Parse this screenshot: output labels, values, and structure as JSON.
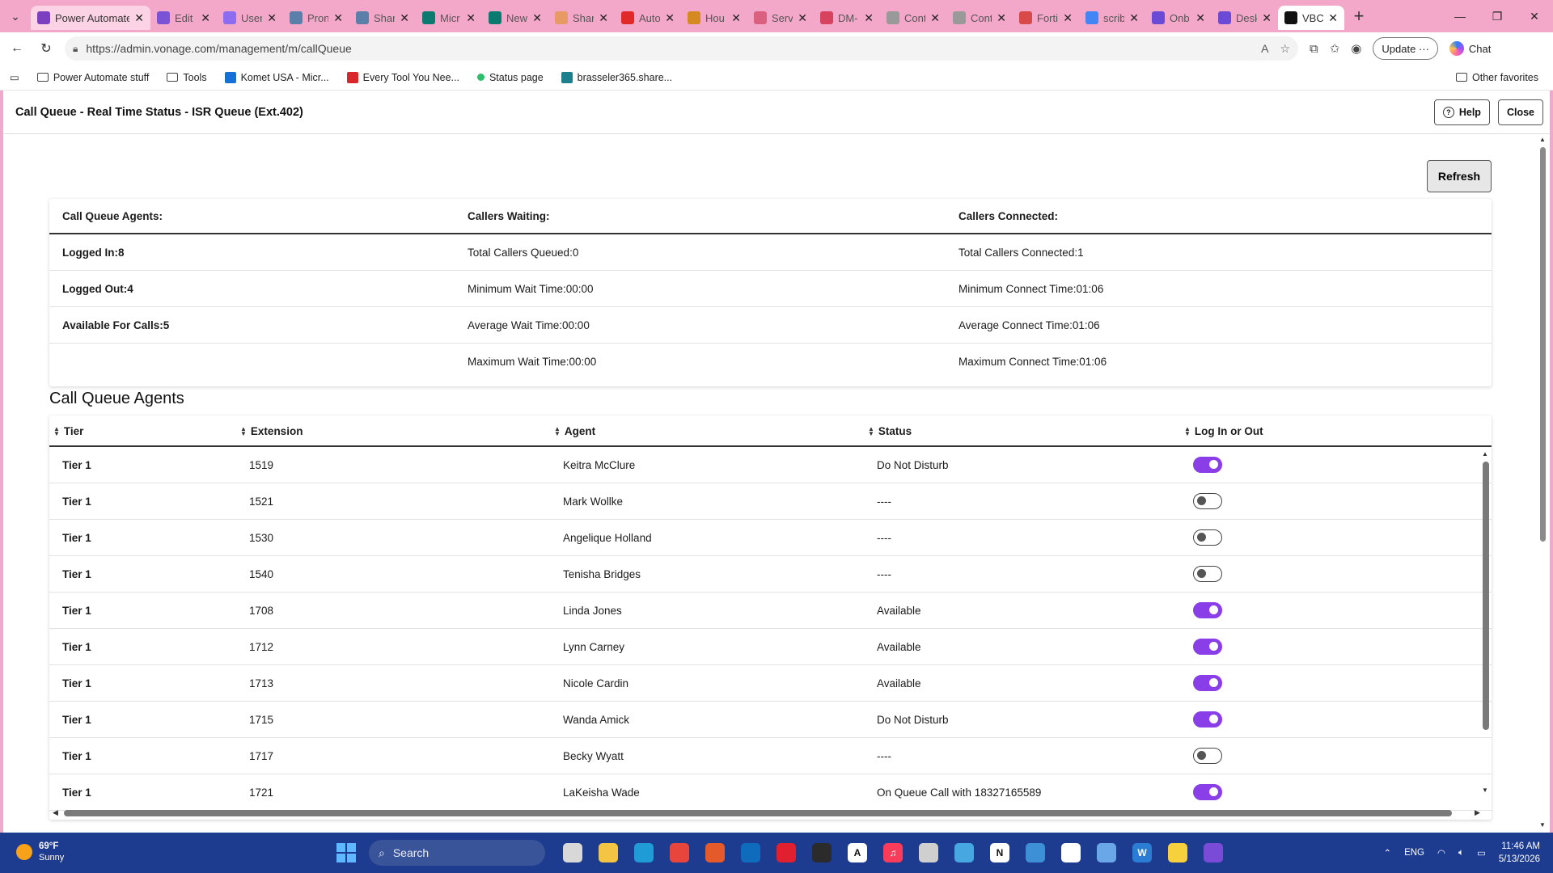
{
  "browser": {
    "tabs": [
      {
        "label": "Power Automate stuff",
        "icon": "windows-workspace-icon",
        "color": "#7b3fbf",
        "pinned": true
      },
      {
        "label": "Edit",
        "icon": "power-apps-icon",
        "color": "#7a52d6"
      },
      {
        "label": "User",
        "icon": "power-automate-icon",
        "color": "#8e6cf0"
      },
      {
        "label": "Pron",
        "icon": "sharepoint-icon",
        "color": "#5a7fa8"
      },
      {
        "label": "Shar",
        "icon": "sharepoint-icon",
        "color": "#5a7fa8"
      },
      {
        "label": "Micr",
        "icon": "ms-forms-icon",
        "color": "#0b7a6f"
      },
      {
        "label": "New",
        "icon": "ms-forms-icon",
        "color": "#0b7a6f"
      },
      {
        "label": "Shar",
        "icon": "office-icon",
        "color": "#e79a63"
      },
      {
        "label": "Auto",
        "icon": "youtube-icon",
        "color": "#e02a2a"
      },
      {
        "label": "Hou",
        "icon": "folder-icon",
        "color": "#d58a21"
      },
      {
        "label": "Serv",
        "icon": "service-icon",
        "color": "#d9607e"
      },
      {
        "label": "DM-",
        "icon": "pdf-icon",
        "color": "#d7425f"
      },
      {
        "label": "Cont",
        "icon": "gear-icon",
        "color": "#999999"
      },
      {
        "label": "Cont",
        "icon": "gear-icon",
        "color": "#999999"
      },
      {
        "label": "Forti",
        "icon": "forti-icon",
        "color": "#d84a4a"
      },
      {
        "label": "scrib",
        "icon": "google-icon",
        "color": "#4285f4"
      },
      {
        "label": "Onb",
        "icon": "search-g-icon",
        "color": "#6b4ad6"
      },
      {
        "label": "Desk",
        "icon": "search-g-icon",
        "color": "#6b4ad6"
      },
      {
        "label": "VBC",
        "icon": "vonage-icon",
        "color": "#111111",
        "active": true
      }
    ],
    "url": "https://admin.vonage.com/management/m/callQueue",
    "update_label": "Update",
    "chat_label": "Chat",
    "favorites": [
      {
        "label": "Power Automate stuff",
        "icon": "folder-icon"
      },
      {
        "label": "Tools",
        "icon": "folder-icon"
      },
      {
        "label": "Komet USA - Micr...",
        "icon": "azure-icon"
      },
      {
        "label": "Every Tool You Nee...",
        "icon": "s-icon"
      },
      {
        "label": "Status page",
        "icon": "status-icon"
      },
      {
        "label": "brasseler365.share...",
        "icon": "sharepoint-icon"
      }
    ],
    "other_favorites": "Other favorites"
  },
  "page": {
    "title": "Call Queue - Real Time Status - ISR Queue (Ext.402)",
    "help_label": "Help",
    "close_label": "Close",
    "refresh_label": "Refresh",
    "stats": {
      "headers": [
        "Call Queue Agents:",
        "Callers Waiting:",
        "Callers Connected:"
      ],
      "rows": [
        [
          "Logged In:8",
          "Total Callers Queued:0",
          "Total Callers Connected:1"
        ],
        [
          "Logged Out:4",
          "Minimum Wait Time:00:00",
          "Minimum Connect Time:01:06"
        ],
        [
          "Available For Calls:5",
          "Average Wait Time:00:00",
          "Average Connect Time:01:06"
        ],
        [
          "",
          "Maximum Wait Time:00:00",
          "Maximum Connect Time:01:06"
        ]
      ]
    },
    "agents_title": "Call Queue Agents",
    "agents_columns": [
      "Tier",
      "Extension",
      "Agent",
      "Status",
      "Log In or Out"
    ],
    "agents": [
      {
        "tier": "Tier 1",
        "ext": "1519",
        "agent": "Keitra McClure",
        "status": "Do Not Disturb",
        "logged_in": true
      },
      {
        "tier": "Tier 1",
        "ext": "1521",
        "agent": "Mark Wollke",
        "status": "----",
        "logged_in": false
      },
      {
        "tier": "Tier 1",
        "ext": "1530",
        "agent": "Angelique Holland",
        "status": "----",
        "logged_in": false
      },
      {
        "tier": "Tier 1",
        "ext": "1540",
        "agent": "Tenisha Bridges",
        "status": "----",
        "logged_in": false
      },
      {
        "tier": "Tier 1",
        "ext": "1708",
        "agent": "Linda Jones",
        "status": "Available",
        "logged_in": true
      },
      {
        "tier": "Tier 1",
        "ext": "1712",
        "agent": "Lynn Carney",
        "status": "Available",
        "logged_in": true
      },
      {
        "tier": "Tier 1",
        "ext": "1713",
        "agent": "Nicole Cardin",
        "status": "Available",
        "logged_in": true
      },
      {
        "tier": "Tier 1",
        "ext": "1715",
        "agent": "Wanda Amick",
        "status": "Do Not Disturb",
        "logged_in": true
      },
      {
        "tier": "Tier 1",
        "ext": "1717",
        "agent": "Becky Wyatt",
        "status": "----",
        "logged_in": false
      },
      {
        "tier": "Tier 1",
        "ext": "1721",
        "agent": "LaKeisha Wade",
        "status": "On Queue Call with 18327165589",
        "logged_in": true
      }
    ],
    "toggle_on_color": "#8a3ee8"
  },
  "taskbar": {
    "temperature": "69°F",
    "condition": "Sunny",
    "search_placeholder": "Search",
    "apps": [
      {
        "icon": "task-view-icon",
        "color": "#d8d8d8",
        "glyph": ""
      },
      {
        "icon": "file-explorer-icon",
        "color": "#f4c542",
        "glyph": ""
      },
      {
        "icon": "edge-icon",
        "color": "#1f9bd6",
        "glyph": ""
      },
      {
        "icon": "chrome-icon",
        "color": "#e8453c",
        "glyph": ""
      },
      {
        "icon": "app-icon",
        "color": "#e55a2b",
        "glyph": ""
      },
      {
        "icon": "outlook-icon",
        "color": "#0f6cbd",
        "glyph": ""
      },
      {
        "icon": "opera-icon",
        "color": "#e0202e",
        "glyph": ""
      },
      {
        "icon": "terminal-icon",
        "color": "#2b2b2b",
        "glyph": ""
      },
      {
        "icon": "font-app-icon",
        "color": "#ffffff",
        "glyph": "A"
      },
      {
        "icon": "music-icon",
        "color": "#fa3c5a",
        "glyph": "♫"
      },
      {
        "icon": "clock-app-icon",
        "color": "#cfcfcf",
        "glyph": ""
      },
      {
        "icon": "notepad-icon",
        "color": "#47a7e0",
        "glyph": ""
      },
      {
        "icon": "notion-icon",
        "color": "#ffffff",
        "glyph": "N"
      },
      {
        "icon": "remote-desktop-icon",
        "color": "#3d8fd6",
        "glyph": ""
      },
      {
        "icon": "teamviewer-icon",
        "color": "#ffffff",
        "glyph": ""
      },
      {
        "icon": "photos-icon",
        "color": "#6aa7e8",
        "glyph": ""
      },
      {
        "icon": "word-icon",
        "color": "#2b7cd3",
        "glyph": "W"
      },
      {
        "icon": "sticky-notes-icon",
        "color": "#f6d03d",
        "glyph": ""
      },
      {
        "icon": "visual-studio-icon",
        "color": "#7a4bd6",
        "glyph": ""
      }
    ],
    "language": "ENG",
    "time": "11:46 AM",
    "date": "5/13/2026"
  }
}
